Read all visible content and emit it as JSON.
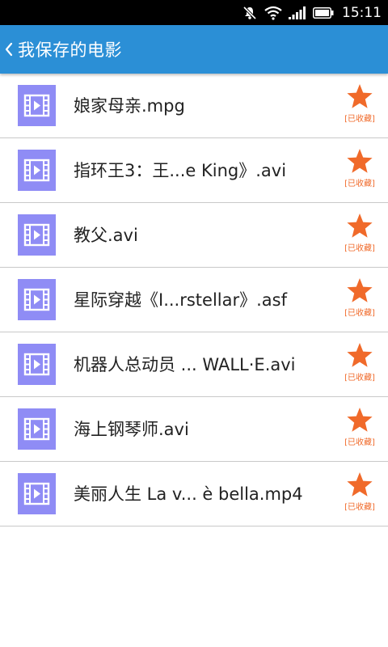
{
  "status_bar": {
    "time": "15:11",
    "icons": [
      "notification-muted-icon",
      "wifi-icon",
      "signal-icon",
      "battery-icon"
    ]
  },
  "header": {
    "back_icon": "chevron-left-icon",
    "title": "我保存的电影"
  },
  "colors": {
    "header_bg": "#2b8fd6",
    "icon_bg": "#8f8cf5",
    "star": "#f06a2a"
  },
  "movies": [
    {
      "name": "娘家母亲.mpg",
      "fav_label": "[已收藏]"
    },
    {
      "name": "指环王3：王...e King》.avi",
      "fav_label": "[已收藏]"
    },
    {
      "name": "教父.avi",
      "fav_label": "[已收藏]"
    },
    {
      "name": "星际穿越《I...rstellar》.asf",
      "fav_label": "[已收藏]"
    },
    {
      "name": "机器人总动员 ... WALL·E.avi",
      "fav_label": "[已收藏]"
    },
    {
      "name": "海上钢琴师.avi",
      "fav_label": "[已收藏]"
    },
    {
      "name": "美丽人生 La v... è bella.mp4",
      "fav_label": "[已收藏]"
    }
  ]
}
